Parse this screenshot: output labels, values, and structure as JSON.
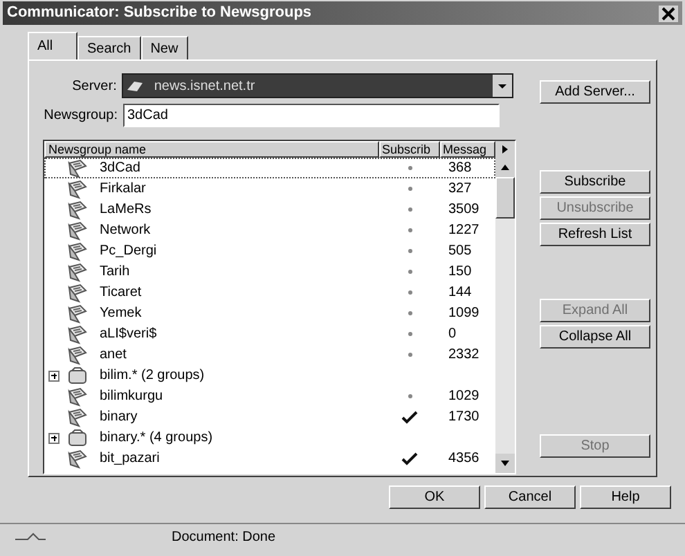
{
  "window": {
    "title": "Communicator: Subscribe to Newsgroups"
  },
  "tabs": [
    {
      "label": "All",
      "selected": true
    },
    {
      "label": "Search",
      "selected": false
    },
    {
      "label": "New",
      "selected": false
    }
  ],
  "server": {
    "label": "Server:",
    "value": "news.isnet.net.tr"
  },
  "newsgroup": {
    "label": "Newsgroup:",
    "value": "3dCad"
  },
  "list": {
    "columns": [
      "Newsgroup name",
      "Subscrib",
      "Messag"
    ],
    "rows": [
      {
        "kind": "group",
        "name": "3dCad",
        "subscribed": false,
        "messages": "368",
        "selected": true
      },
      {
        "kind": "group",
        "name": "Firkalar",
        "subscribed": false,
        "messages": "327",
        "selected": false
      },
      {
        "kind": "group",
        "name": "LaMeRs",
        "subscribed": false,
        "messages": "3509",
        "selected": false
      },
      {
        "kind": "group",
        "name": "Network",
        "subscribed": false,
        "messages": "1227",
        "selected": false
      },
      {
        "kind": "group",
        "name": "Pc_Dergi",
        "subscribed": false,
        "messages": "505",
        "selected": false
      },
      {
        "kind": "group",
        "name": "Tarih",
        "subscribed": false,
        "messages": "150",
        "selected": false
      },
      {
        "kind": "group",
        "name": "Ticaret",
        "subscribed": false,
        "messages": "144",
        "selected": false
      },
      {
        "kind": "group",
        "name": "Yemek",
        "subscribed": false,
        "messages": "1099",
        "selected": false
      },
      {
        "kind": "group",
        "name": "aLI$veri$",
        "subscribed": false,
        "messages": "0",
        "selected": false
      },
      {
        "kind": "group",
        "name": "anet",
        "subscribed": false,
        "messages": "2332",
        "selected": false
      },
      {
        "kind": "folder",
        "name": "bilim.* (2 groups)",
        "expanded": false,
        "selected": false
      },
      {
        "kind": "group",
        "name": "bilimkurgu",
        "subscribed": false,
        "messages": "1029",
        "selected": false
      },
      {
        "kind": "group",
        "name": "binary",
        "subscribed": true,
        "messages": "1730",
        "selected": false
      },
      {
        "kind": "folder",
        "name": "binary.* (4 groups)",
        "expanded": false,
        "selected": false
      },
      {
        "kind": "group",
        "name": "bit_pazari",
        "subscribed": true,
        "messages": "4356",
        "selected": false
      }
    ]
  },
  "side_buttons": [
    {
      "label": "Add Server...",
      "disabled": false
    },
    {
      "label": "Subscribe",
      "disabled": false
    },
    {
      "label": "Unsubscribe",
      "disabled": true
    },
    {
      "label": "Refresh List",
      "disabled": false
    },
    {
      "label": "Expand All",
      "disabled": true
    },
    {
      "label": "Collapse All",
      "disabled": false
    },
    {
      "label": "Stop",
      "disabled": true
    }
  ],
  "footer_buttons": [
    {
      "label": "OK"
    },
    {
      "label": "Cancel"
    },
    {
      "label": "Help"
    }
  ],
  "status_bar": {
    "text": "Document: Done"
  }
}
